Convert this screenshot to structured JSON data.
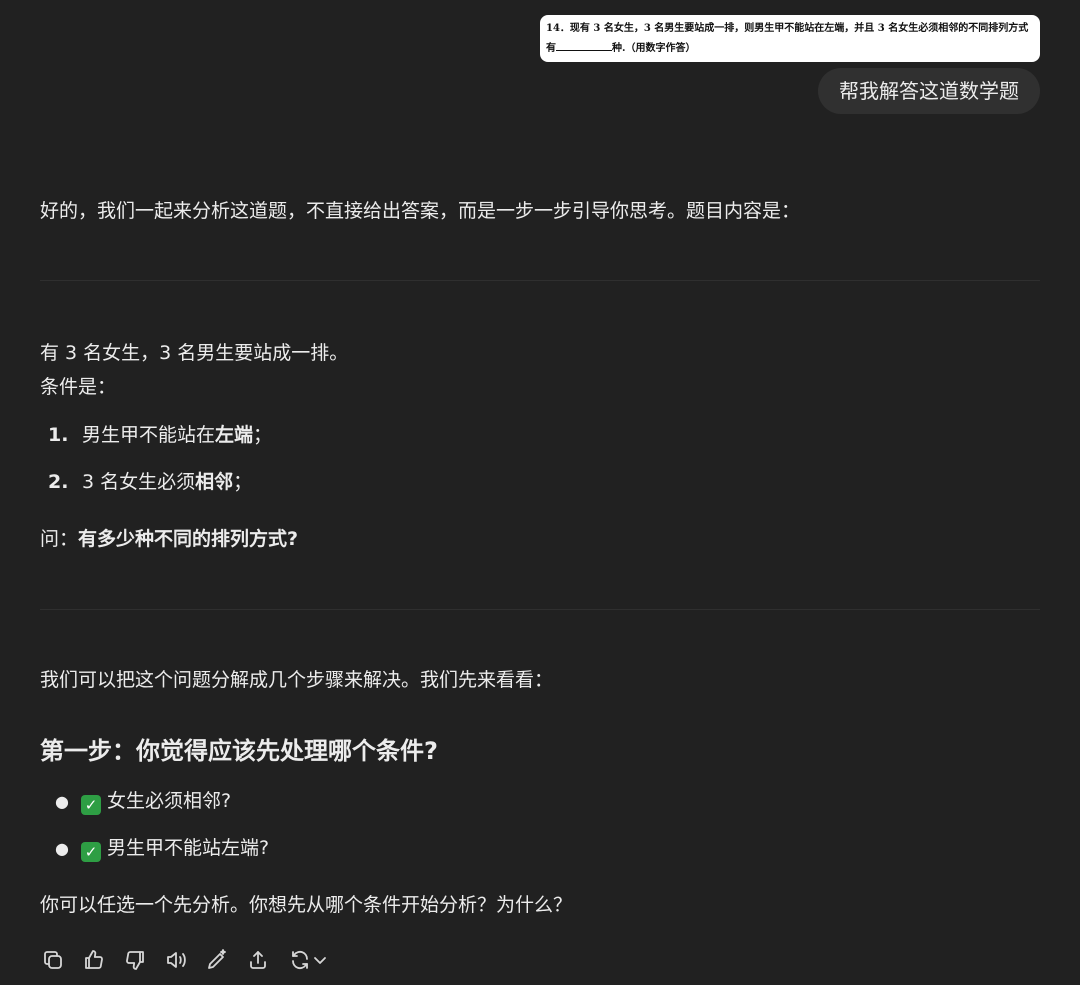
{
  "user_message": {
    "image_text_line1": "14．现有 3 名女生，3 名男生要站成一排，则男生甲不能站在左端，并且 3 名女生必须相邻的不同排列方式",
    "image_text_line2_prefix": "有",
    "image_text_line2_suffix": "种.（用数字作答）",
    "text": "帮我解答这道数学题"
  },
  "assistant": {
    "intro": "好的，我们一起来分析这道题，不直接给出答案，而是一步一步引导你思考。题目内容是：",
    "problem_line1": "有 3 名女生，3 名男生要站成一排。",
    "conditions_label": "条件是：",
    "conditions": [
      {
        "num": "1.",
        "prefix": "男生甲不能站在",
        "bold": "左端",
        "suffix": "；"
      },
      {
        "num": "2.",
        "prefix": "3 名女生必须",
        "bold": "相邻",
        "suffix": "；"
      }
    ],
    "question_prefix": "问：",
    "question_bold": "有多少种不同的排列方式?",
    "decompose": "我们可以把这个问题分解成几个步骤来解决。我们先来看看：",
    "step1_heading": "第一步：你觉得应该先处理哪个条件?",
    "options": [
      {
        "check": "✓",
        "text": "女生必须相邻?"
      },
      {
        "check": "✓",
        "text": "男生甲不能站左端?"
      }
    ],
    "closing": "你可以任选一个先分析。你想先从哪个条件开始分析？为什么？"
  },
  "actions": [
    "copy-icon",
    "thumbs-up-icon",
    "thumbs-down-icon",
    "read-aloud-icon",
    "edit-icon",
    "share-icon",
    "regenerate-icon"
  ],
  "colors": {
    "background": "#212121",
    "bubble": "#303030",
    "text": "#ececec",
    "check_green": "#2e9e44"
  }
}
